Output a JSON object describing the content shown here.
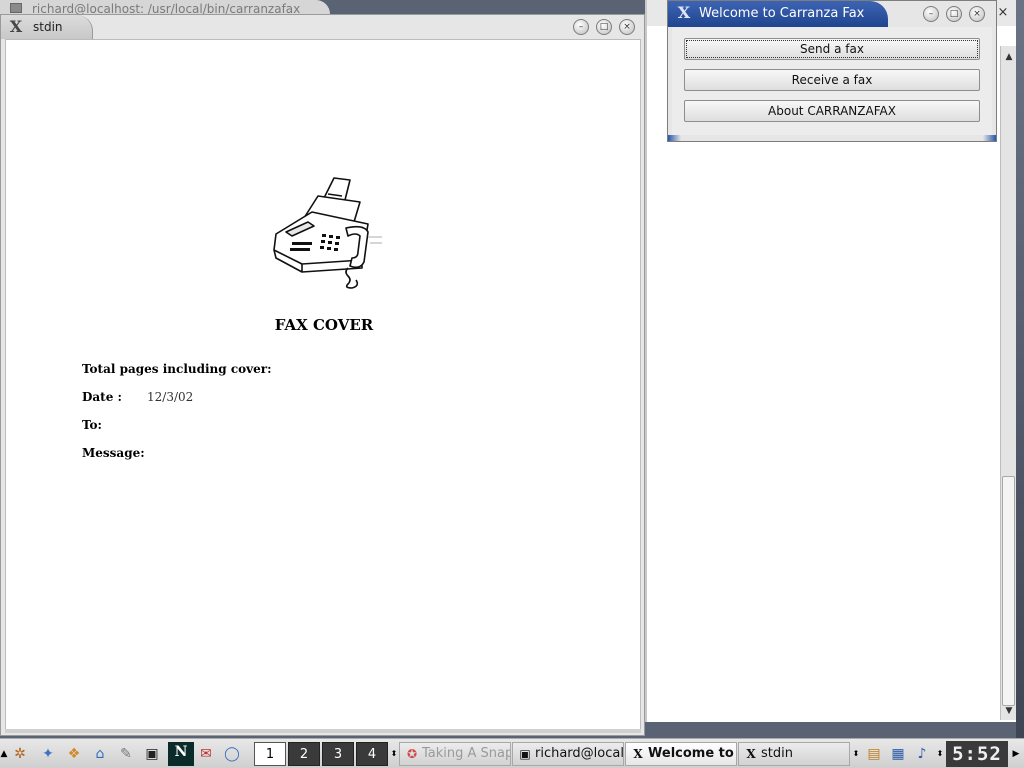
{
  "background_window": {
    "title": "richard@localhost: /usr/local/bin/carranzafax"
  },
  "main_window": {
    "close_glyph": "×",
    "scroll_up": "▲",
    "scroll_down": "▼"
  },
  "stdin_window": {
    "title": "stdin",
    "logo": "X",
    "buttons": {
      "minimize": "–",
      "maximize": "□",
      "close": "×"
    },
    "document": {
      "title": "FAX COVER",
      "total_pages_label": "Total pages including cover:",
      "date_label": "Date :",
      "date_value": "12/3/02",
      "to_label": "To:",
      "message_label": "Message:"
    }
  },
  "welcome_dialog": {
    "title": "Welcome to Carranza Fax",
    "logo": "X",
    "buttons": {
      "minimize": "–",
      "maximize": "□",
      "close": "×"
    },
    "actions": [
      {
        "label": "Send a fax"
      },
      {
        "label": "Receive a fax"
      },
      {
        "label": "About CARRANZAFAX"
      }
    ]
  },
  "taskbar": {
    "pager": [
      "1",
      "2",
      "3",
      "4"
    ],
    "tasks": [
      {
        "label": "Taking A Snap",
        "icon": "lifebuoy-icon"
      },
      {
        "label": "richard@local",
        "icon": "terminal-icon"
      },
      {
        "label": "Welcome to C",
        "icon": "x-icon"
      },
      {
        "label": "stdin",
        "icon": "x-icon"
      }
    ],
    "clock": "5:52"
  }
}
